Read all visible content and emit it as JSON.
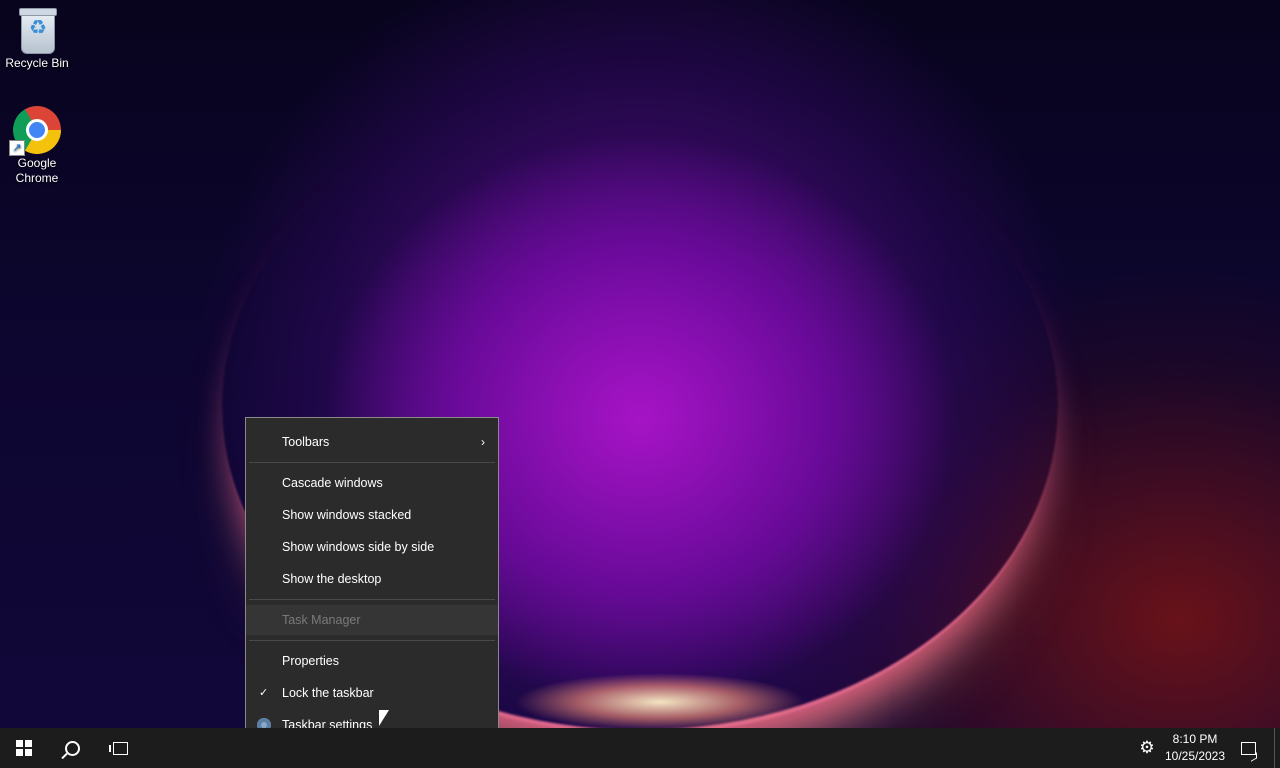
{
  "desktop": {
    "icons": [
      {
        "label": "Recycle Bin",
        "icon": "recycle-bin-icon"
      },
      {
        "label": "Google\nChrome",
        "icon": "chrome-icon"
      }
    ]
  },
  "context_menu": {
    "items": [
      {
        "label": "Toolbars",
        "submenu": true
      },
      {
        "label": "Cascade windows"
      },
      {
        "label": "Show windows stacked"
      },
      {
        "label": "Show windows side by side"
      },
      {
        "label": "Show the desktop"
      },
      {
        "label": "Task Manager",
        "disabled": true
      },
      {
        "label": "Properties"
      },
      {
        "label": "Lock the taskbar",
        "checked": true
      },
      {
        "label": "Taskbar settings",
        "icon": "settings-gear-icon"
      }
    ]
  },
  "taskbar": {
    "time": "8:10 PM",
    "date": "10/25/2023",
    "buttons": [
      "start-icon",
      "search-icon",
      "task-view-icon"
    ]
  },
  "colors": {
    "menu_bg": "#2b2b2b",
    "taskbar_bg": "#1c1c1c",
    "disabled_text": "#7a7a7a"
  }
}
